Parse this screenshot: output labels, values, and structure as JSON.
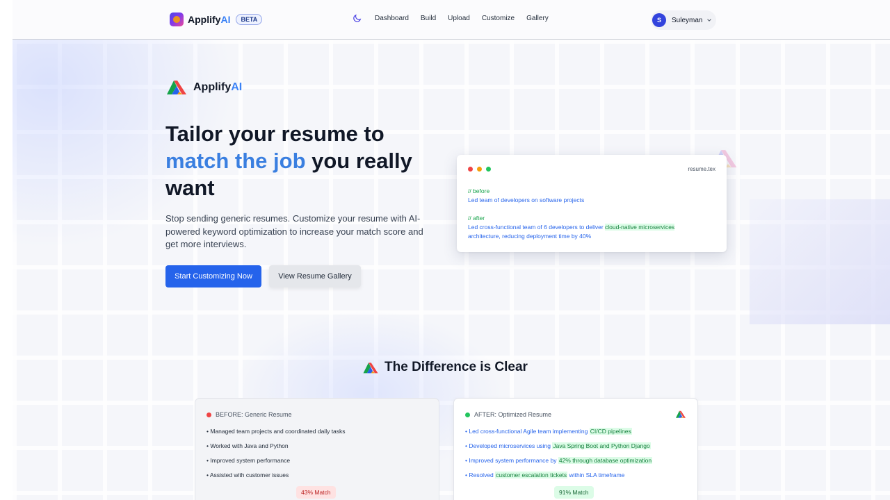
{
  "nav": {
    "brand_prefix": "Applify",
    "brand_suffix": "AI",
    "beta": "BETA",
    "links": [
      "Dashboard",
      "Build",
      "Upload",
      "Customize",
      "Gallery"
    ],
    "user_initial": "S",
    "user_name": "Suleyman",
    "icons": [
      "moon-icon",
      "chevron-down-icon"
    ]
  },
  "hero": {
    "logo_prefix": "Applify",
    "logo_suffix": "AI",
    "headline_part1": "Tailor your resume to",
    "headline_highlight": "match the job",
    "headline_part2": " you really want",
    "subcopy": "Stop sending generic resumes. Customize your resume with AI-powered keyword optimization to increase your match score and get more interviews.",
    "primary_cta": "Start Customizing Now",
    "secondary_cta": "View Resume Gallery"
  },
  "code_card": {
    "filename": "resume.tex",
    "before_comment": "// before",
    "before_line": "Led team of developers on software projects",
    "after_comment": "// after",
    "after_line1_a": "Led cross-functional team of 6 developers to deliver ",
    "after_line1_hl": "cloud-native microservices",
    "after_line2": "architecture, reducing deployment time by 40%"
  },
  "comparison": {
    "title": "The Difference is Clear",
    "before": {
      "label": "BEFORE: Generic Resume",
      "items": [
        "• Managed team projects and coordinated daily tasks",
        "• Worked with Java and Python",
        "• Improved system performance",
        "• Assisted with customer issues"
      ],
      "score": "43% Match"
    },
    "after": {
      "label": "AFTER: Optimized Resume",
      "item1_a": "• Led cross-functional Agile team implementing ",
      "item1_hl": "CI/CD pipelines",
      "item2_a": "• Developed microservices using ",
      "item2_hl": "Java Spring Boot and Python Django",
      "item3_a": "• Improved system performance by ",
      "item3_hl": "42% through database optimization",
      "item4_a": "• Resolved ",
      "item4_hl": "customer escalation tickets",
      "item4_b": " within SLA timeframe",
      "score": "91% Match"
    }
  },
  "colors": {
    "accent": "#2563eb",
    "headline_highlight": "#3a7fe0",
    "before_dot": "#ef4444",
    "after_dot": "#22c55e"
  }
}
